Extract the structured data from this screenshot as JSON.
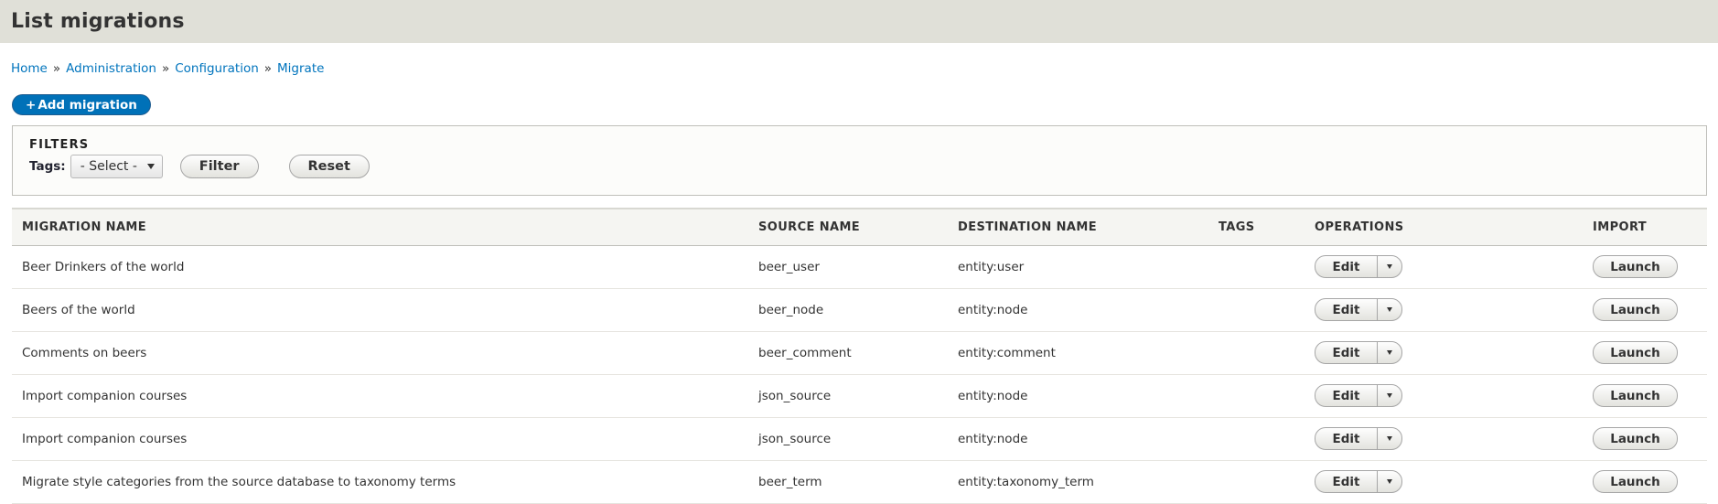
{
  "page": {
    "title": "List migrations"
  },
  "breadcrumb": {
    "items": [
      "Home",
      "Administration",
      "Configuration",
      "Migrate"
    ],
    "separator": "»"
  },
  "actions": {
    "add_migration_icon": "+",
    "add_migration_label": "Add migration"
  },
  "filters": {
    "legend": "FILTERS",
    "tags_label": "Tags:",
    "tags_selected": "- Select -",
    "filter_button": "Filter",
    "reset_button": "Reset"
  },
  "table": {
    "headers": {
      "name": "MIGRATION NAME",
      "source": "SOURCE NAME",
      "destination": "DESTINATION NAME",
      "tags": "TAGS",
      "operations": "OPERATIONS",
      "import": "IMPORT"
    },
    "rows": [
      {
        "name": "Beer Drinkers of the world",
        "source": "beer_user",
        "destination": "entity:user",
        "tags": "",
        "operation": "Edit",
        "import": "Launch"
      },
      {
        "name": "Beers of the world",
        "source": "beer_node",
        "destination": "entity:node",
        "tags": "",
        "operation": "Edit",
        "import": "Launch"
      },
      {
        "name": "Comments on beers",
        "source": "beer_comment",
        "destination": "entity:comment",
        "tags": "",
        "operation": "Edit",
        "import": "Launch"
      },
      {
        "name": "Import companion courses",
        "source": "json_source",
        "destination": "entity:node",
        "tags": "",
        "operation": "Edit",
        "import": "Launch"
      },
      {
        "name": "Import companion courses",
        "source": "json_source",
        "destination": "entity:node",
        "tags": "",
        "operation": "Edit",
        "import": "Launch"
      },
      {
        "name": "Migrate style categories from the source database to taxonomy terms",
        "source": "beer_term",
        "destination": "entity:taxonomy_term",
        "tags": "",
        "operation": "Edit",
        "import": "Launch"
      }
    ]
  },
  "colors": {
    "header_bg": "#e0e0d8",
    "link": "#0074bd",
    "primary_button": "#0071b8"
  }
}
